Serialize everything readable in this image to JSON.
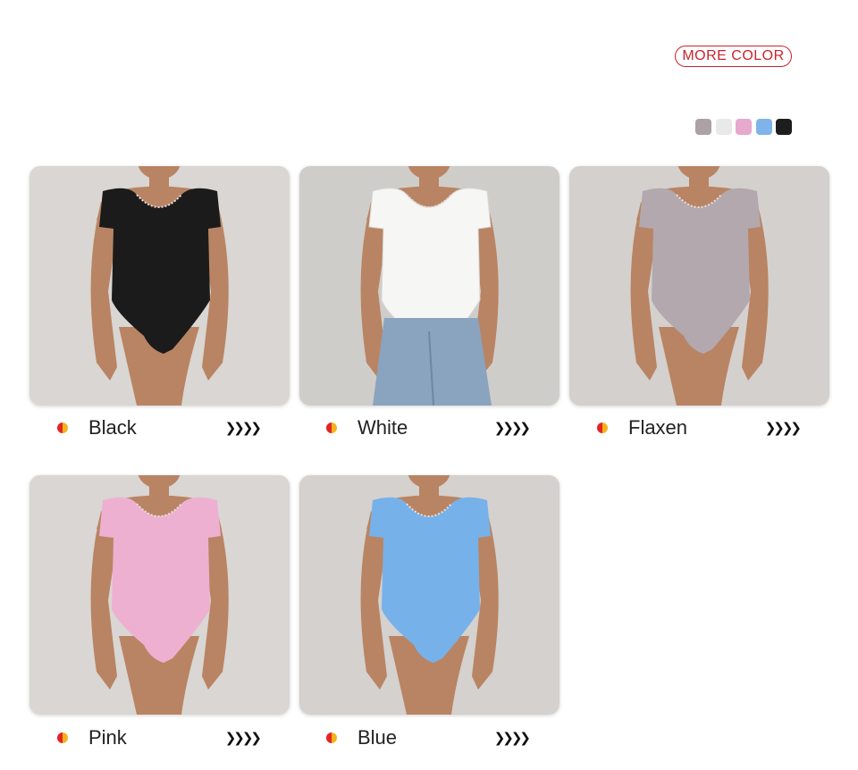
{
  "header": {
    "more_color_label": "MORE COLOR",
    "swatches": [
      {
        "name": "flaxen",
        "color": "#aca1a6"
      },
      {
        "name": "white",
        "color": "#e9e9e9"
      },
      {
        "name": "pink",
        "color": "#e7a9cd"
      },
      {
        "name": "blue",
        "color": "#7fb4ea"
      },
      {
        "name": "black",
        "color": "#1d1d1d"
      }
    ]
  },
  "products": [
    {
      "name": "Black",
      "garment_color": "#1b1b1b",
      "arrows": "❯❯❯❯",
      "background": "#d9d6d3"
    },
    {
      "name": "White",
      "garment_color": "#f6f6f4",
      "arrows": "❯❯❯❯",
      "background": "#cfcdca"
    },
    {
      "name": "Flaxen",
      "garment_color": "#b2a8ae",
      "arrows": "❯❯❯❯",
      "background": "#d4d0cd"
    },
    {
      "name": "Pink",
      "garment_color": "#eeb0d1",
      "arrows": "❯❯❯❯",
      "background": "#d9d6d3"
    },
    {
      "name": "Blue",
      "garment_color": "#77b1ea",
      "arrows": "❯❯❯❯",
      "background": "#d4d1ce"
    }
  ],
  "colors": {
    "accent": "#c8242b",
    "skin": "#b98463",
    "jeans": "#8aa3bf"
  }
}
